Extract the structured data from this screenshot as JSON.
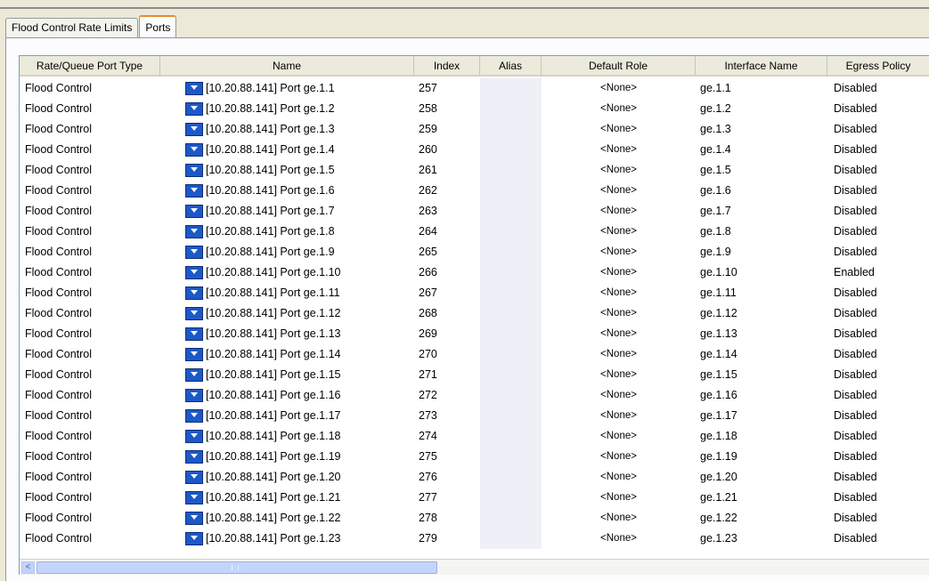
{
  "tabs": [
    "Flood Control Rate Limits",
    "Ports"
  ],
  "active_tab": "Ports",
  "columns": {
    "type": "Rate/Queue Port Type",
    "name": "Name",
    "index": "Index",
    "alias": "Alias",
    "role": "Default Role",
    "iface": "Interface Name",
    "egress": "Egress Policy"
  },
  "rows": [
    {
      "type": "Flood Control",
      "name": "[10.20.88.141] Port ge.1.1",
      "index": "257",
      "alias": "",
      "role": "<None>",
      "iface": "ge.1.1",
      "egress": "Disabled"
    },
    {
      "type": "Flood Control",
      "name": "[10.20.88.141] Port ge.1.2",
      "index": "258",
      "alias": "",
      "role": "<None>",
      "iface": "ge.1.2",
      "egress": "Disabled"
    },
    {
      "type": "Flood Control",
      "name": "[10.20.88.141] Port ge.1.3",
      "index": "259",
      "alias": "",
      "role": "<None>",
      "iface": "ge.1.3",
      "egress": "Disabled"
    },
    {
      "type": "Flood Control",
      "name": "[10.20.88.141] Port ge.1.4",
      "index": "260",
      "alias": "",
      "role": "<None>",
      "iface": "ge.1.4",
      "egress": "Disabled"
    },
    {
      "type": "Flood Control",
      "name": "[10.20.88.141] Port ge.1.5",
      "index": "261",
      "alias": "",
      "role": "<None>",
      "iface": "ge.1.5",
      "egress": "Disabled"
    },
    {
      "type": "Flood Control",
      "name": "[10.20.88.141] Port ge.1.6",
      "index": "262",
      "alias": "",
      "role": "<None>",
      "iface": "ge.1.6",
      "egress": "Disabled"
    },
    {
      "type": "Flood Control",
      "name": "[10.20.88.141] Port ge.1.7",
      "index": "263",
      "alias": "",
      "role": "<None>",
      "iface": "ge.1.7",
      "egress": "Disabled"
    },
    {
      "type": "Flood Control",
      "name": "[10.20.88.141] Port ge.1.8",
      "index": "264",
      "alias": "",
      "role": "<None>",
      "iface": "ge.1.8",
      "egress": "Disabled"
    },
    {
      "type": "Flood Control",
      "name": "[10.20.88.141] Port ge.1.9",
      "index": "265",
      "alias": "",
      "role": "<None>",
      "iface": "ge.1.9",
      "egress": "Disabled"
    },
    {
      "type": "Flood Control",
      "name": "[10.20.88.141] Port ge.1.10",
      "index": "266",
      "alias": "",
      "role": "<None>",
      "iface": "ge.1.10",
      "egress": "Enabled"
    },
    {
      "type": "Flood Control",
      "name": "[10.20.88.141] Port ge.1.11",
      "index": "267",
      "alias": "",
      "role": "<None>",
      "iface": "ge.1.11",
      "egress": "Disabled"
    },
    {
      "type": "Flood Control",
      "name": "[10.20.88.141] Port ge.1.12",
      "index": "268",
      "alias": "",
      "role": "<None>",
      "iface": "ge.1.12",
      "egress": "Disabled"
    },
    {
      "type": "Flood Control",
      "name": "[10.20.88.141] Port ge.1.13",
      "index": "269",
      "alias": "",
      "role": "<None>",
      "iface": "ge.1.13",
      "egress": "Disabled"
    },
    {
      "type": "Flood Control",
      "name": "[10.20.88.141] Port ge.1.14",
      "index": "270",
      "alias": "",
      "role": "<None>",
      "iface": "ge.1.14",
      "egress": "Disabled"
    },
    {
      "type": "Flood Control",
      "name": "[10.20.88.141] Port ge.1.15",
      "index": "271",
      "alias": "",
      "role": "<None>",
      "iface": "ge.1.15",
      "egress": "Disabled"
    },
    {
      "type": "Flood Control",
      "name": "[10.20.88.141] Port ge.1.16",
      "index": "272",
      "alias": "",
      "role": "<None>",
      "iface": "ge.1.16",
      "egress": "Disabled"
    },
    {
      "type": "Flood Control",
      "name": "[10.20.88.141] Port ge.1.17",
      "index": "273",
      "alias": "",
      "role": "<None>",
      "iface": "ge.1.17",
      "egress": "Disabled"
    },
    {
      "type": "Flood Control",
      "name": "[10.20.88.141] Port ge.1.18",
      "index": "274",
      "alias": "",
      "role": "<None>",
      "iface": "ge.1.18",
      "egress": "Disabled"
    },
    {
      "type": "Flood Control",
      "name": "[10.20.88.141] Port ge.1.19",
      "index": "275",
      "alias": "",
      "role": "<None>",
      "iface": "ge.1.19",
      "egress": "Disabled"
    },
    {
      "type": "Flood Control",
      "name": "[10.20.88.141] Port ge.1.20",
      "index": "276",
      "alias": "",
      "role": "<None>",
      "iface": "ge.1.20",
      "egress": "Disabled"
    },
    {
      "type": "Flood Control",
      "name": "[10.20.88.141] Port ge.1.21",
      "index": "277",
      "alias": "",
      "role": "<None>",
      "iface": "ge.1.21",
      "egress": "Disabled"
    },
    {
      "type": "Flood Control",
      "name": "[10.20.88.141] Port ge.1.22",
      "index": "278",
      "alias": "",
      "role": "<None>",
      "iface": "ge.1.22",
      "egress": "Disabled"
    },
    {
      "type": "Flood Control",
      "name": "[10.20.88.141] Port ge.1.23",
      "index": "279",
      "alias": "",
      "role": "<None>",
      "iface": "ge.1.23",
      "egress": "Disabled"
    }
  ],
  "icons": {
    "row": "port-icon",
    "scroll_left": "scroll-left-arrow-icon",
    "scroll_left_glyph": "<"
  },
  "colors": {
    "active_tab_accent": "#e68b2c",
    "port_icon": "#1d58c7",
    "alias_column_bg": "#efeff7"
  }
}
